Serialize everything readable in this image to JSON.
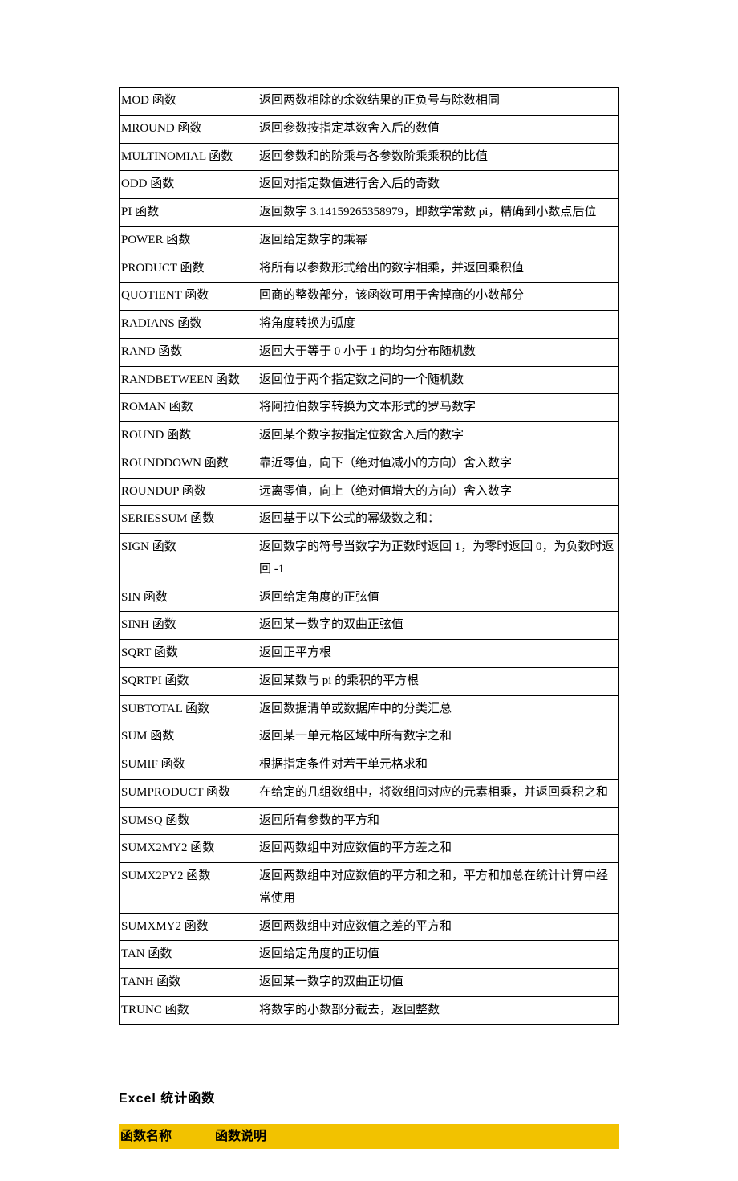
{
  "functions": [
    {
      "name": "MOD 函数",
      "desc": "返回两数相除的余数结果的正负号与除数相同"
    },
    {
      "name": "MROUND 函数",
      "desc": "返回参数按指定基数舍入后的数值"
    },
    {
      "name": "MULTINOMIAL 函数",
      "desc": "返回参数和的阶乘与各参数阶乘乘积的比值"
    },
    {
      "name": "ODD 函数",
      "desc": "返回对指定数值进行舍入后的奇数"
    },
    {
      "name": "PI 函数",
      "desc": "返回数字 3.14159265358979，即数学常数 pi，精确到小数点后位"
    },
    {
      "name": "POWER 函数",
      "desc": "返回给定数字的乘幂"
    },
    {
      "name": "PRODUCT 函数",
      "desc": "将所有以参数形式给出的数字相乘，并返回乘积值"
    },
    {
      "name": "QUOTIENT 函数",
      "desc": "回商的整数部分，该函数可用于舍掉商的小数部分"
    },
    {
      "name": "RADIANS 函数",
      "desc": "将角度转换为弧度"
    },
    {
      "name": "RAND 函数",
      "desc": "返回大于等于 0 小于 1 的均匀分布随机数"
    },
    {
      "name": "RANDBETWEEN 函数",
      "desc": "返回位于两个指定数之间的一个随机数"
    },
    {
      "name": "ROMAN 函数",
      "desc": "将阿拉伯数字转换为文本形式的罗马数字"
    },
    {
      "name": "ROUND 函数",
      "desc": "返回某个数字按指定位数舍入后的数字"
    },
    {
      "name": "ROUNDDOWN 函数",
      "desc": "靠近零值，向下（绝对值减小的方向）舍入数字"
    },
    {
      "name": "ROUNDUP 函数",
      "desc": "远离零值，向上（绝对值增大的方向）舍入数字"
    },
    {
      "name": "SERIESSUM 函数",
      "desc": "返回基于以下公式的幂级数之和："
    },
    {
      "name": "SIGN 函数",
      "desc": "返回数字的符号当数字为正数时返回 1，为零时返回 0，为负数时返回 -1"
    },
    {
      "name": "SIN 函数",
      "desc": "返回给定角度的正弦值"
    },
    {
      "name": "SINH 函数",
      "desc": "返回某一数字的双曲正弦值"
    },
    {
      "name": "SQRT 函数",
      "desc": "返回正平方根"
    },
    {
      "name": "SQRTPI 函数",
      "desc": "返回某数与 pi 的乘积的平方根"
    },
    {
      "name": "SUBTOTAL 函数",
      "desc": "返回数据清单或数据库中的分类汇总"
    },
    {
      "name": "SUM 函数",
      "desc": "返回某一单元格区域中所有数字之和"
    },
    {
      "name": "SUMIF 函数",
      "desc": "根据指定条件对若干单元格求和"
    },
    {
      "name": "SUMPRODUCT 函数",
      "desc": "在给定的几组数组中，将数组间对应的元素相乘，并返回乘积之和"
    },
    {
      "name": "SUMSQ 函数",
      "desc": "返回所有参数的平方和"
    },
    {
      "name": "SUMX2MY2 函数",
      "desc": "返回两数组中对应数值的平方差之和"
    },
    {
      "name": "SUMX2PY2 函数",
      "desc": "返回两数组中对应数值的平方和之和，平方和加总在统计计算中经常使用"
    },
    {
      "name": "SUMXMY2 函数",
      "desc": "返回两数组中对应数值之差的平方和"
    },
    {
      "name": "TAN 函数",
      "desc": "返回给定角度的正切值"
    },
    {
      "name": "TANH 函数",
      "desc": "返回某一数字的双曲正切值"
    },
    {
      "name": "TRUNC 函数",
      "desc": "将数字的小数部分截去，返回整数"
    }
  ],
  "section_title": "Excel 统计函数",
  "header": {
    "col1": "函数名称",
    "col2": "函数说明"
  }
}
